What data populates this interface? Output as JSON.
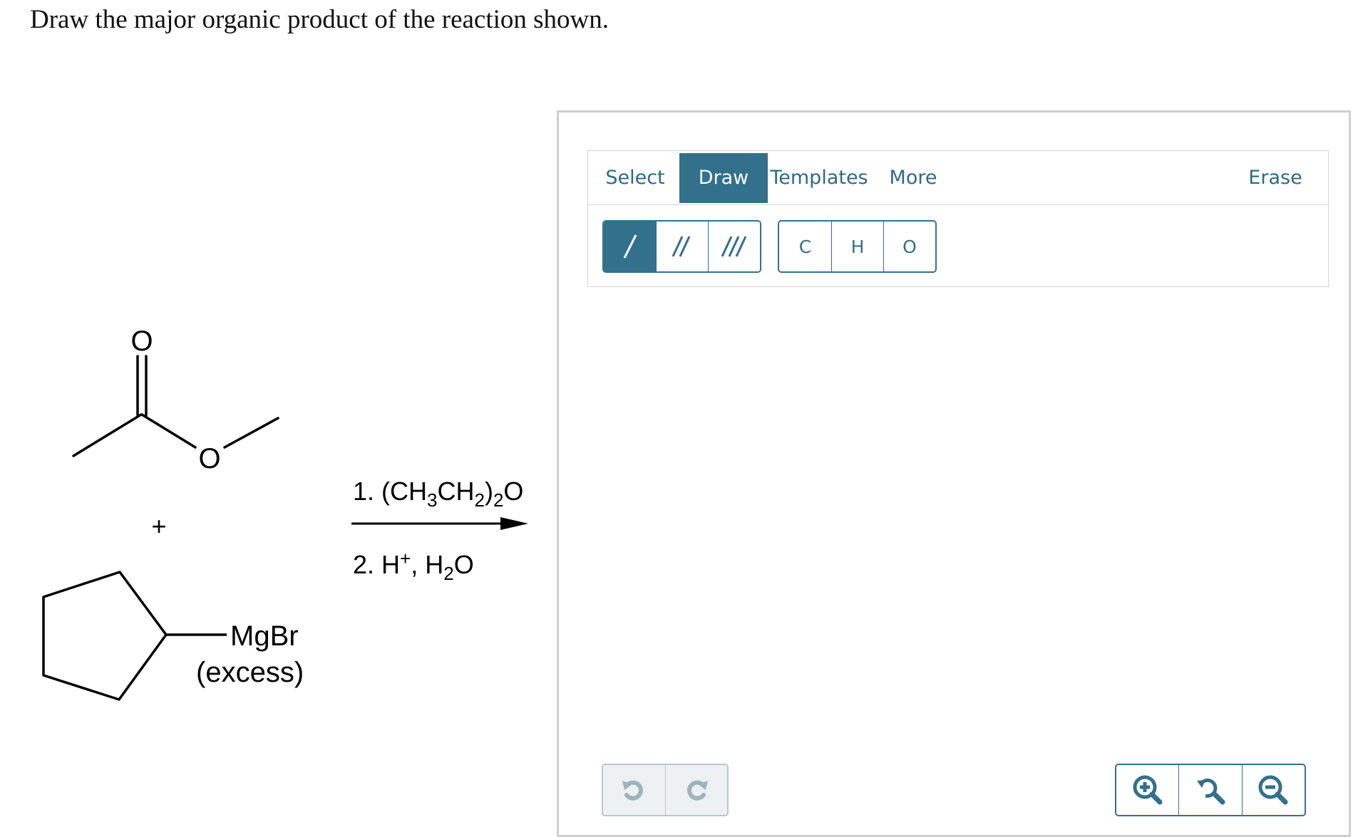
{
  "question": {
    "prompt": "Draw the major organic product of the reaction shown."
  },
  "reaction": {
    "reactant1_atoms": [
      "O",
      "O"
    ],
    "plus_sign": "+",
    "reactant2_group": "MgBr",
    "reactant2_note": "(excess)",
    "step1": {
      "prefix": "1. (CH",
      "sub1": "3",
      "mid": "CH",
      "sub2": "2",
      "close": ")",
      "sub3": "2",
      "suffix": "O"
    },
    "step2": {
      "prefix": "2. H",
      "sup": "+",
      "mid": ", H",
      "sub": "2",
      "suffix": "O"
    }
  },
  "editor": {
    "tabs": [
      {
        "label": "Select",
        "active": false
      },
      {
        "label": "Draw",
        "active": true
      },
      {
        "label": "Templates",
        "active": false
      },
      {
        "label": "More",
        "active": false
      }
    ],
    "erase_label": "Erase",
    "bond_tools": [
      {
        "icon": "single-bond-icon",
        "active": true
      },
      {
        "icon": "double-bond-icon",
        "active": false
      },
      {
        "icon": "triple-bond-icon",
        "active": false
      }
    ],
    "atom_tools": [
      "C",
      "H",
      "O"
    ],
    "history_tools": [
      "undo-icon",
      "redo-icon"
    ],
    "zoom_tools": [
      "zoom-in-icon",
      "zoom-reset-icon",
      "zoom-out-icon"
    ],
    "colors": {
      "accent": "#33708c",
      "tab_text": "#2e6b85",
      "disabled_bg": "#eef1f3",
      "disabled_icon": "#9fb3bd"
    }
  }
}
